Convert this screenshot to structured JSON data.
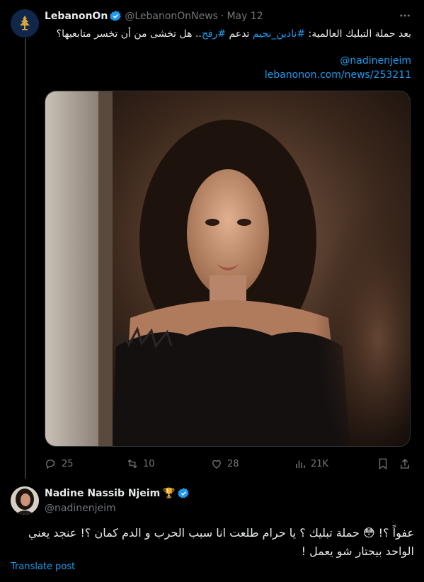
{
  "tweet1": {
    "display_name": "LebanonOn",
    "handle": "@LebanonOnNews",
    "separator": "·",
    "date": "May 12",
    "text_part1": "بعد حملة التبليك العالمية: ",
    "hashtag1": "#نادين_نجيم",
    "text_part2": " تدعم ",
    "hashtag2": "#رفح",
    "text_part3": ".. هل تخشى من أن تخسر متابعيها؟",
    "mention": "@nadinenjeim",
    "url": "lebanonon.com/news/253211",
    "stats": {
      "replies": "25",
      "reposts": "10",
      "likes": "28",
      "views": "21K"
    }
  },
  "tweet2": {
    "display_name": "Nadine Nassib Njeim",
    "badge_emoji": "🏆",
    "handle": "@nadinenjeim",
    "text_part1": "عفواً ؟! ",
    "emoji": "😳",
    "text_part2": " حملة تبليك ؟ يا حرام طلعت انا سبب الحرب و الدم كمان ؟! عنجد يعني الواحد بيحتار شو يعمل !",
    "translate_label": "Translate post"
  },
  "icons": {
    "avatar1": "lebanon-cedar-icon",
    "verified": "verified-badge-icon",
    "more": "more-icon",
    "reply": "reply-icon",
    "repost": "repost-icon",
    "like": "heart-icon",
    "views": "views-chart-icon",
    "bookmark": "bookmark-icon",
    "share": "share-icon"
  },
  "colors": {
    "background": "#000000",
    "text": "#e7e9ea",
    "muted": "#71767b",
    "link": "#1d9bf0",
    "verified": "#1d9bf0",
    "divider": "#2f3336"
  }
}
